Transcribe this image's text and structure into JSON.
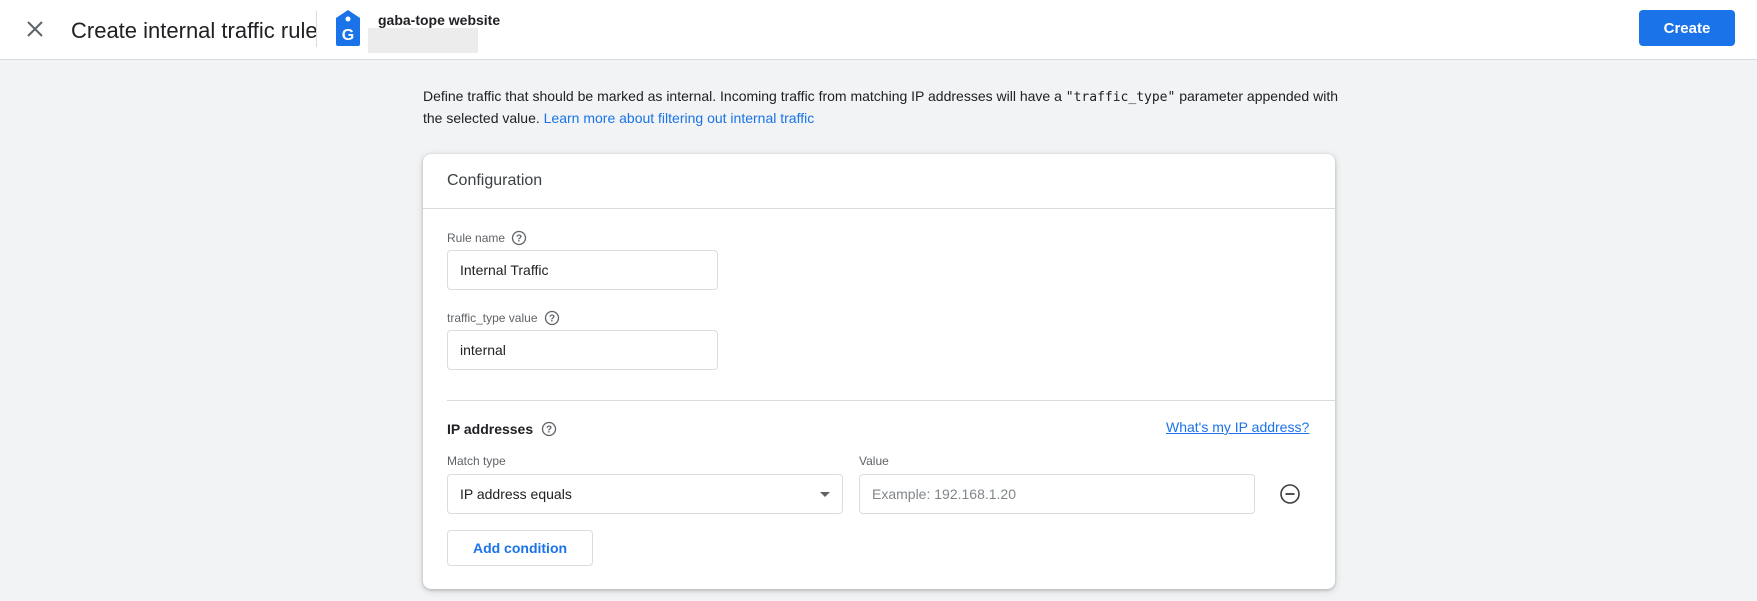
{
  "header": {
    "title": "Create internal traffic rule",
    "property_name": "gaba-tope website",
    "create_label": "Create"
  },
  "intro": {
    "text_before": "Define traffic that should be marked as internal. Incoming traffic from matching IP addresses will have a ",
    "code": "\"traffic_type\"",
    "text_after": " parameter appended with the selected value. ",
    "link": "Learn more about filtering out internal traffic"
  },
  "config": {
    "title": "Configuration",
    "rule_name_label": "Rule name",
    "rule_name_value": "Internal Traffic",
    "traffic_type_label": "traffic_type value",
    "traffic_type_value": "internal",
    "ip_section_title": "IP addresses",
    "ip_link": "What's my IP address?",
    "match_type_label": "Match type",
    "match_type_value": "IP address equals",
    "value_label": "Value",
    "value_placeholder": "Example: 192.168.1.20",
    "add_condition_label": "Add condition"
  },
  "colors": {
    "accent": "#1a73e8",
    "background": "#f1f3f4",
    "border": "#dadce0"
  },
  "icons": {
    "close": "close-icon",
    "property": "analytics-property-icon",
    "help": "help-circle-icon",
    "dropdown": "caret-down-icon",
    "remove": "remove-circle-icon"
  }
}
